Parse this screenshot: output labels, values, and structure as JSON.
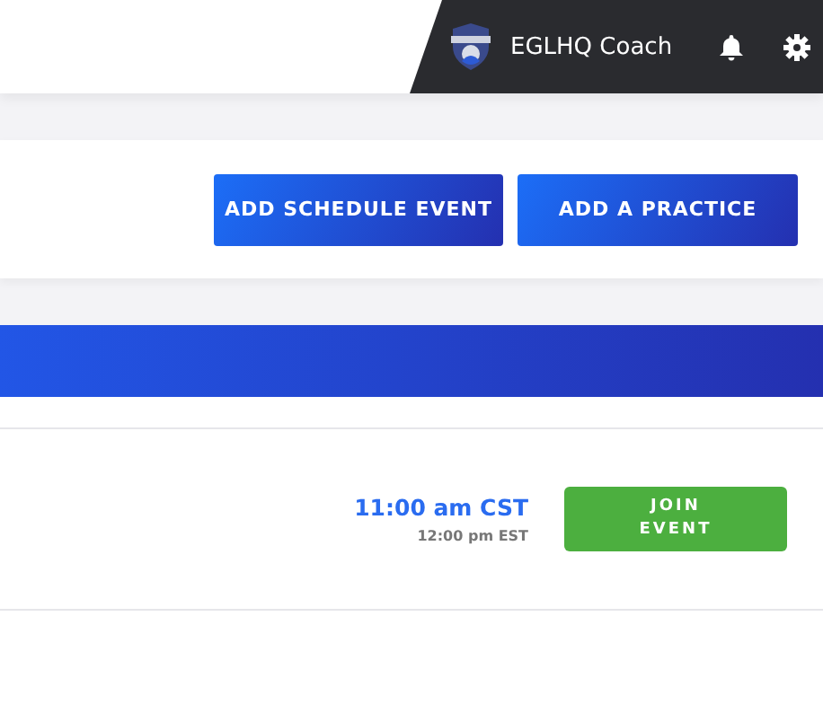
{
  "header": {
    "user_name": "EGLHQ Coach"
  },
  "actions": [
    "ADD SCHEDULE EVENT",
    "ADD A PRACTICE"
  ],
  "event": {
    "time": "11:00 am CST",
    "alt_time": "12:00 pm EST",
    "join_label": "JOIN EVENT"
  }
}
